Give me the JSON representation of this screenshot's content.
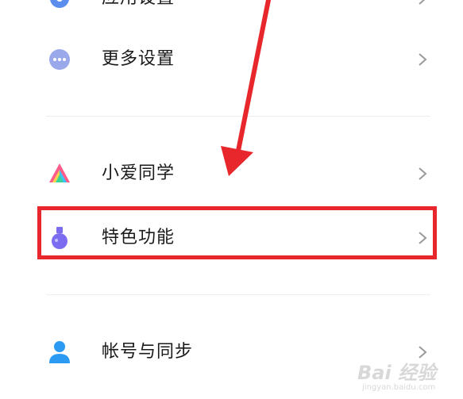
{
  "settings": {
    "items": [
      {
        "label": "应用设置",
        "icon": "gear-icon"
      },
      {
        "label": "更多设置",
        "icon": "more-dots-icon"
      },
      {
        "label": "小爱同学",
        "icon": "xiaoai-icon"
      },
      {
        "label": "特色功能",
        "icon": "flask-icon"
      },
      {
        "label": "帐号与同步",
        "icon": "person-icon"
      }
    ]
  },
  "annotation": {
    "highlight_color": "#e8272c"
  },
  "watermark": {
    "logo": "Bai 经验",
    "url": "jingyan.baidu.com"
  }
}
